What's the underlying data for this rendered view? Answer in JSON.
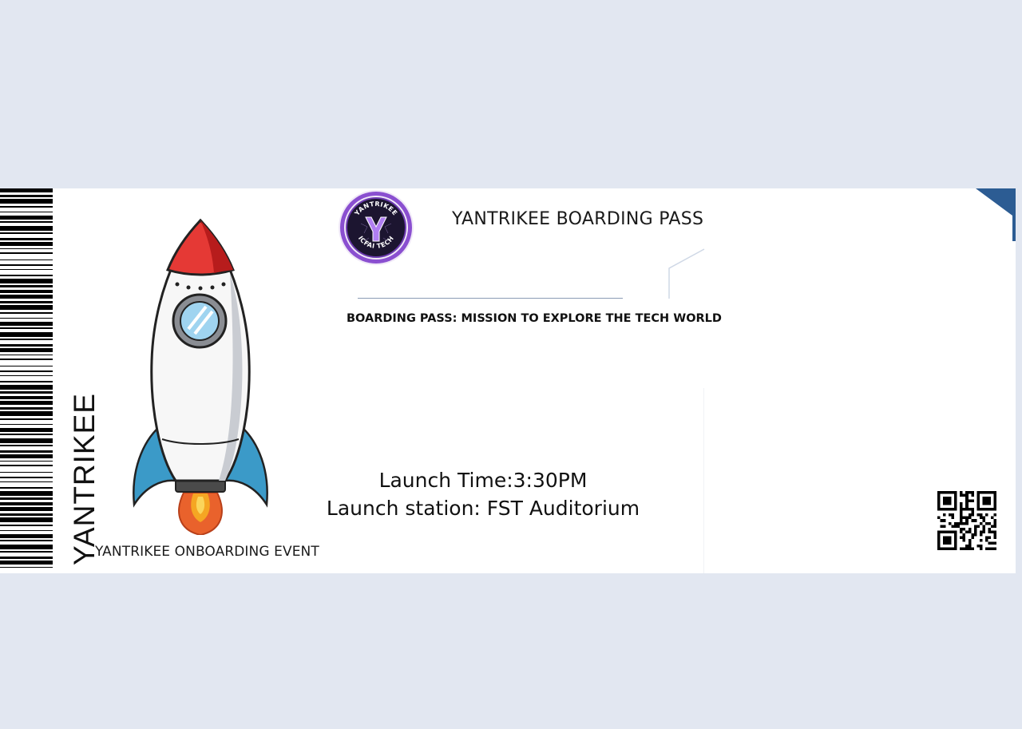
{
  "ticket": {
    "side_text": "YANTRIKEE",
    "event_label": "YANTRIKEE ONBOARDING EVENT",
    "title": "YANTRIKEE BOARDING PASS",
    "subtitle": "BOARDING PASS: MISSION TO EXPLORE THE TECH WORLD",
    "launch_time": "Launch Time:3:30PM",
    "launch_station": "Launch station: FST Auditorium"
  },
  "logo": {
    "top_text": "YANTRIKEE",
    "bottom_text": "ICFAI TECH",
    "icon": "yantrikee-logo-icon"
  },
  "icons": {
    "barcode": "barcode-icon",
    "rocket": "rocket-icon",
    "qr": "qr-code-icon"
  },
  "colors": {
    "background": "#e2e7f1",
    "ticket": "#ffffff",
    "accent": "#2c5c93",
    "logo_purple": "#7b3fc4"
  }
}
